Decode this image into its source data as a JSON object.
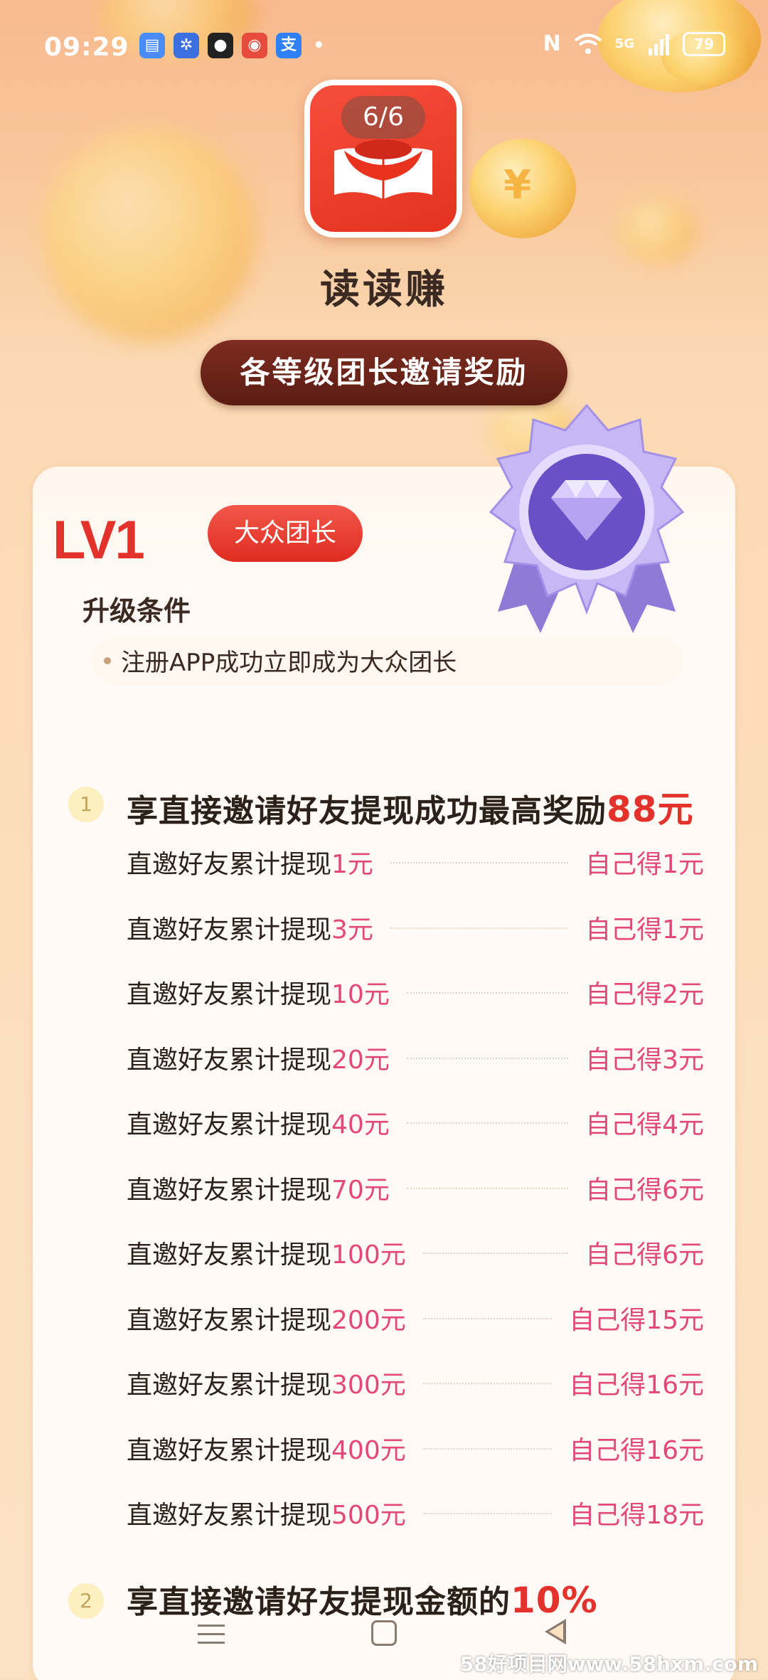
{
  "status_bar": {
    "time": "09:29",
    "apps": [
      {
        "name": "message-app-icon",
        "glyph": "■",
        "color": "#4a8cf7"
      },
      {
        "name": "pinwheel-app-icon",
        "glyph": "✲",
        "color": "#3b6fe0"
      },
      {
        "name": "qq-app-icon",
        "glyph": "●",
        "color": "#222222"
      },
      {
        "name": "weibo-app-icon",
        "glyph": "◉",
        "color": "#e64b3c"
      },
      {
        "name": "alipay-app-icon",
        "glyph": "支",
        "color": "#2f7ff5"
      }
    ],
    "network": "5G",
    "battery": "79"
  },
  "page_counter": "6/6",
  "app_name": "读读赚",
  "banner": "各等级团长邀请奖励",
  "level": {
    "code": "LV1",
    "badge": "大众团长",
    "condition_title": "升级条件",
    "condition_text": "注册APP成功立即成为大众团长"
  },
  "section1": {
    "number": "1",
    "title": "享直接邀请好友提现成功最高奖励",
    "highlight": "88元"
  },
  "row_prefix": "直邀好友累计提现",
  "rows": [
    {
      "amount": "1元",
      "reward": "自己得1元"
    },
    {
      "amount": "3元",
      "reward": "自己得1元"
    },
    {
      "amount": "10元",
      "reward": "自己得2元"
    },
    {
      "amount": "20元",
      "reward": "自己得3元"
    },
    {
      "amount": "40元",
      "reward": "自己得4元"
    },
    {
      "amount": "70元",
      "reward": "自己得6元"
    },
    {
      "amount": "100元",
      "reward": "自己得6元"
    },
    {
      "amount": "200元",
      "reward": "自己得15元"
    },
    {
      "amount": "300元",
      "reward": "自己得16元"
    },
    {
      "amount": "400元",
      "reward": "自己得16元"
    },
    {
      "amount": "500元",
      "reward": "自己得18元"
    }
  ],
  "section2": {
    "number": "2",
    "title": "享直接邀请好友提现金额的",
    "highlight": "10%"
  },
  "watermark": "58好项目网www.58hxm.com"
}
